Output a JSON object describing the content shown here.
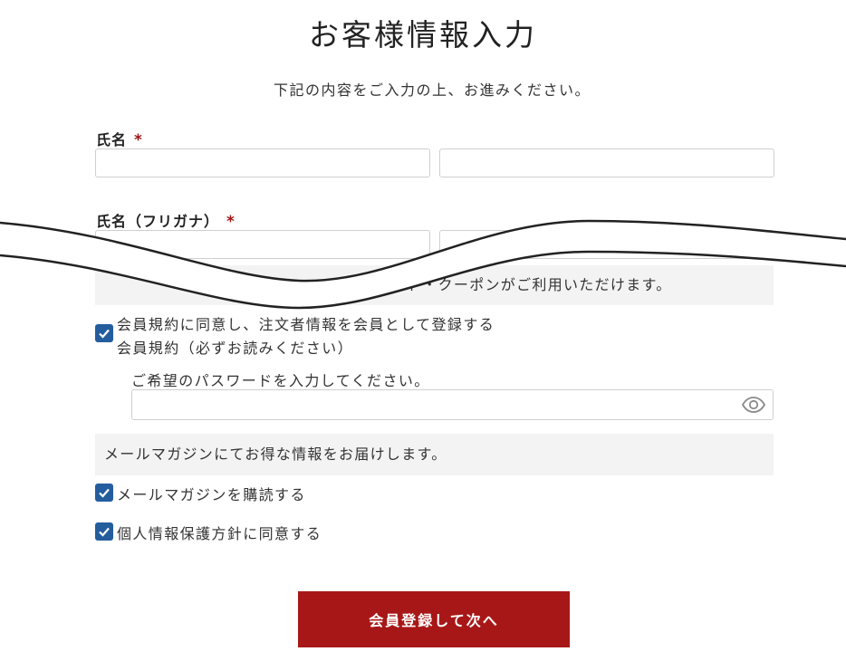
{
  "page": {
    "title": "お客様情報入力",
    "subtitle": "下記の内容をご入力の上、お進みください。"
  },
  "form": {
    "name": {
      "label": "氏名",
      "required_mark": "*"
    },
    "furigana": {
      "label": "氏名（フリガナ）",
      "required_mark": "*"
    },
    "member_notice": "ド・クーポンがご利用いただけます。",
    "register_checkbox": {
      "checked": true,
      "label": "会員規約に同意し、注文者情報を会員として登録する"
    },
    "terms_link": "会員規約（必ずお読みください）",
    "password": {
      "label": "ご希望のパスワードを入力してください。",
      "icon": "eye-icon"
    },
    "newsletter_notice": "メールマガジンにてお得な情報をお届けします。",
    "newsletter_checkbox": {
      "checked": true,
      "label": "メールマガジンを購読する"
    },
    "privacy_checkbox": {
      "checked": true,
      "label": "個人情報保護方針に同意する"
    },
    "submit_label": "会員登録して次へ"
  },
  "colors": {
    "accent": "#a81717",
    "checkbox": "#245d9e",
    "notice_bg": "#f3f3f3"
  }
}
